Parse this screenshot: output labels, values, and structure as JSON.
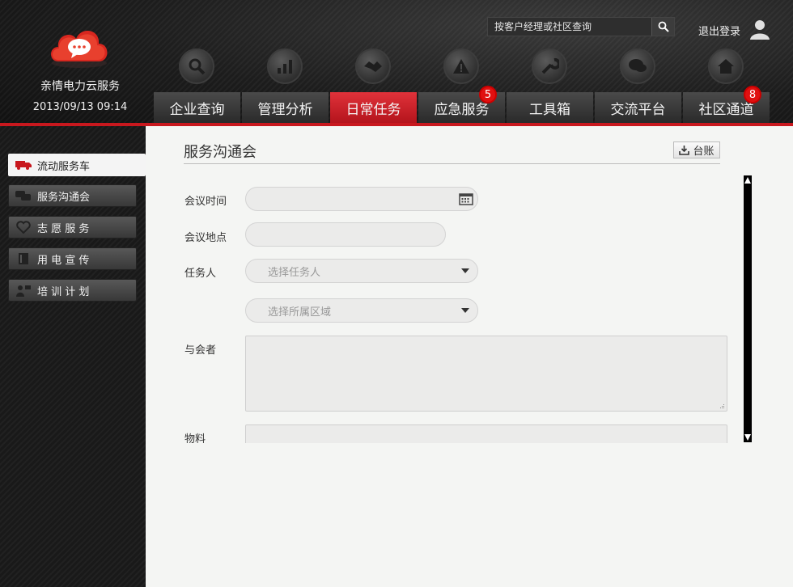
{
  "brand": {
    "name": "亲情电力云服务",
    "datetime": "2013/09/13 09:14"
  },
  "header": {
    "search_placeholder": "按客户经理或社区查询",
    "logout_label": "退出登录"
  },
  "nav": {
    "tabs": [
      {
        "label": "企业查询",
        "icon": "search-icon"
      },
      {
        "label": "管理分析",
        "icon": "bar-chart-icon"
      },
      {
        "label": "日常任务",
        "icon": "handshake-icon",
        "active": true
      },
      {
        "label": "应急服务",
        "icon": "warning-icon",
        "badge": "5"
      },
      {
        "label": "工具箱",
        "icon": "wrench-icon"
      },
      {
        "label": "交流平台",
        "icon": "chat-icon"
      },
      {
        "label": "社区通道",
        "icon": "home-icon",
        "badge": "8"
      }
    ]
  },
  "sidebar": {
    "items": [
      {
        "label": "流动服务车",
        "icon": "truck-icon",
        "active": true
      },
      {
        "label": "服务沟通会",
        "icon": "chat-bubbles-icon"
      },
      {
        "label": "志 愿 服 务",
        "icon": "heart-icon"
      },
      {
        "label": "用 电 宣 传",
        "icon": "book-icon"
      },
      {
        "label": "培 训 计 划",
        "icon": "trainer-icon"
      }
    ]
  },
  "form": {
    "title": "服务沟通会",
    "ledger_label": "台账",
    "fields": {
      "meeting_time_label": "会议时间",
      "meeting_place_label": "会议地点",
      "assignee_label": "任务人",
      "assignee_placeholder": "选择任务人",
      "area_placeholder": "选择所属区域",
      "attendees_label": "与会者",
      "materials_label": "物料"
    }
  },
  "colors": {
    "accent": "#c8181e",
    "badge": "#e01010",
    "main_bg": "#f4f5f3"
  }
}
